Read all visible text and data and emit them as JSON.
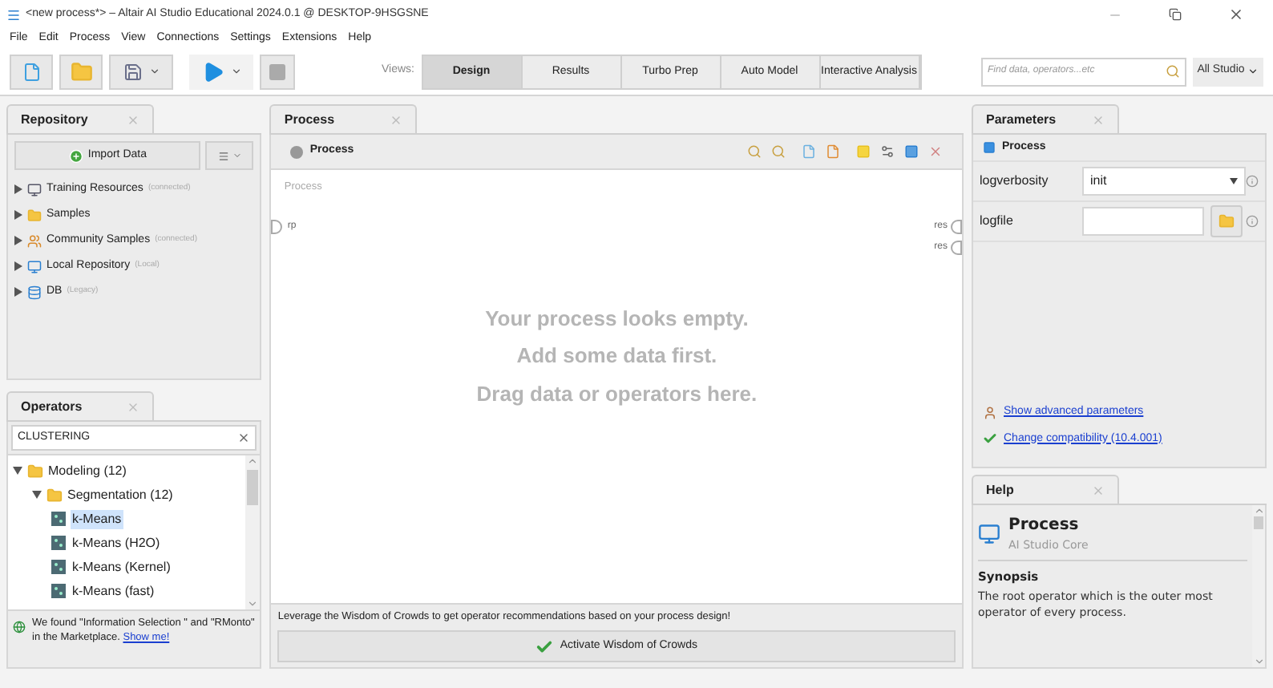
{
  "window": {
    "title": "<new process*> – Altair AI Studio Educational 2024.0.1 @ DESKTOP-9HSGSNE"
  },
  "menu": [
    "File",
    "Edit",
    "Process",
    "View",
    "Connections",
    "Settings",
    "Extensions",
    "Help"
  ],
  "toolbar": {
    "views_label": "Views:",
    "views": [
      {
        "label": "Design",
        "selected": true
      },
      {
        "label": "Results",
        "selected": false
      },
      {
        "label": "Turbo Prep",
        "selected": false
      },
      {
        "label": "Auto Model",
        "selected": false
      },
      {
        "label": "Interactive Analysis",
        "selected": false
      }
    ],
    "search": {
      "placeholder": "Find data, operators...etc"
    },
    "scope": "All Studio"
  },
  "repository": {
    "title": "Repository",
    "import_button": "Import Data",
    "items": [
      {
        "kind": "training",
        "label": "Training Resources",
        "note": "(connected)"
      },
      {
        "kind": "folder",
        "label": "Samples"
      },
      {
        "kind": "community",
        "label": "Community Samples",
        "note": "(connected)"
      },
      {
        "kind": "local",
        "label": "Local Repository",
        "note": "(Local)"
      },
      {
        "kind": "db",
        "label": "DB",
        "note": "(Legacy)"
      }
    ]
  },
  "operators": {
    "title": "Operators",
    "search_value": "CLUSTERING",
    "tree": [
      {
        "label": "Modeling (12)",
        "expanded": true,
        "children": [
          {
            "label": "Segmentation (12)",
            "expanded": true,
            "children": [
              {
                "label": "k-Means",
                "selected": true
              },
              {
                "label": "k-Means (H2O)",
                "selected": false
              },
              {
                "label": "k-Means (Kernel)",
                "selected": false
              },
              {
                "label": "k-Means (fast)",
                "selected": false
              }
            ]
          }
        ]
      }
    ],
    "notice": {
      "text": "We found \"Information Selection \" and \"RMonto\" in the Marketplace.",
      "link": "Show me!"
    }
  },
  "process": {
    "tab": "Process",
    "breadcrumb": "Process",
    "canvas_label": "Process",
    "input_ports": [
      "rp"
    ],
    "output_ports": [
      "res",
      "res"
    ],
    "empty_message": [
      "Your process looks empty.",
      "Add some data first.",
      "Drag data or operators here."
    ],
    "wisdom": {
      "text": "Leverage the Wisdom of Crowds to get operator recommendations based on your process design!",
      "button": "Activate Wisdom of Crowds"
    }
  },
  "parameters": {
    "title": "Parameters",
    "operator": "Process",
    "rows": [
      {
        "kind": "select",
        "label": "logverbosity",
        "value": "init"
      },
      {
        "kind": "file",
        "label": "logfile"
      }
    ],
    "links": [
      {
        "kind": "advanced",
        "label": "Show advanced parameters"
      },
      {
        "kind": "compat",
        "label": "Change compatibility (10.4.001)"
      }
    ]
  },
  "help": {
    "title": "Help",
    "operator": "Process",
    "source": "AI Studio Core",
    "section": "Synopsis",
    "text": "The root operator which is the outer most operator of every process."
  }
}
